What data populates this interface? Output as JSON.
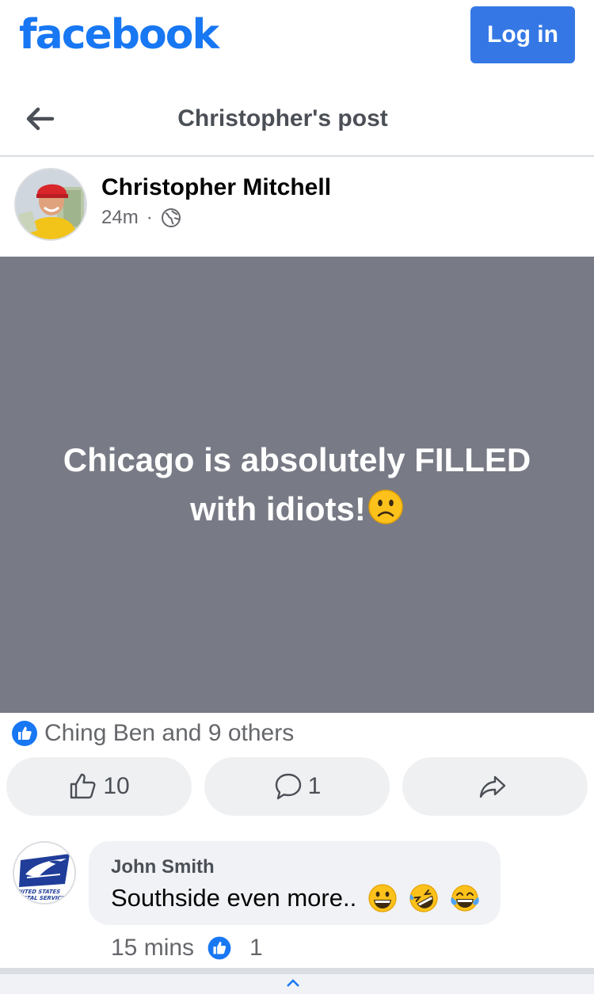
{
  "header": {
    "logo_text": "facebook",
    "login_label": "Log in",
    "brand_color": "#1877f2",
    "button_color": "#3578e5"
  },
  "post_header": {
    "title": "Christopher's post",
    "back_icon": "arrow-left-icon"
  },
  "author": {
    "name": "Christopher Mitchell",
    "time": "24m",
    "separator": "·",
    "privacy_icon": "globe-icon"
  },
  "post": {
    "text": "Chicago is absolutely FILLED with idiots!",
    "emoji": "slightly-frowning-face-icon",
    "background_color": "#787b85"
  },
  "reactions": {
    "summary": "Ching Ben and 9 others",
    "icon": "like-badge-icon"
  },
  "actions": {
    "like_count": "10",
    "comment_count": "1",
    "like_icon": "thumbs-up-icon",
    "comment_icon": "speech-bubble-icon",
    "share_icon": "share-arrow-icon"
  },
  "comment": {
    "author": "John Smith",
    "avatar_icon": "usps-eagle-logo",
    "avatar_text": "UNITED STATES POSTAL SERVICE",
    "text": "Southside even more..",
    "emojis": [
      "grinning-face-icon",
      "rolling-on-floor-laughing-icon",
      "tears-of-joy-icon"
    ],
    "time": "15 mins",
    "like_count": "1"
  }
}
